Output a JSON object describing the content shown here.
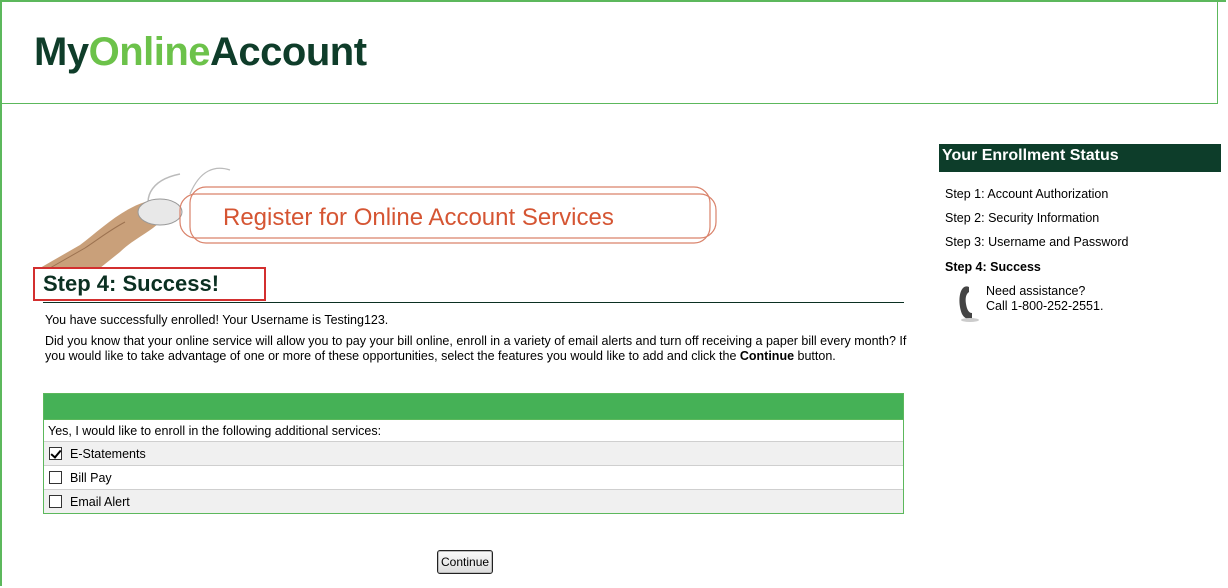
{
  "header": {
    "logo_part1": "My",
    "logo_part2": "Online",
    "logo_part3": "Account"
  },
  "banner": {
    "title": "Register for Online Account Services"
  },
  "step": {
    "title": "Step 4: Success!"
  },
  "messages": {
    "success": "You have successfully enrolled!  Your Username is Testing123.",
    "info_pre": "Did you know that your online service will allow you to pay your bill online, enroll in a variety of email alerts and turn off receiving a paper bill every month?  If you would like to take advantage of one or more of these opportunities, select the features you would like to add and click the ",
    "info_bold": "Continue",
    "info_post": " button."
  },
  "services": {
    "intro": "Yes, I would like to enroll in the following additional services:",
    "items": [
      {
        "label": "E-Statements",
        "checked": true
      },
      {
        "label": "Bill Pay",
        "checked": false
      },
      {
        "label": "Email Alert",
        "checked": false
      }
    ]
  },
  "continue_label": "Continue",
  "sidebar": {
    "title": "Your Enrollment Status",
    "steps": [
      "Step 1: Account Authorization",
      "Step 2: Security Information",
      "Step 3: Username and Password",
      "Step 4: Success"
    ],
    "assist_line1": "Need assistance?",
    "assist_line2": "Call 1-800-252-2551."
  },
  "colors": {
    "brand_dark": "#0d3d2a",
    "brand_green": "#6cc24a",
    "table_green": "#45b156",
    "banner_orange": "#d55533",
    "highlight_red": "#d32f2f"
  }
}
